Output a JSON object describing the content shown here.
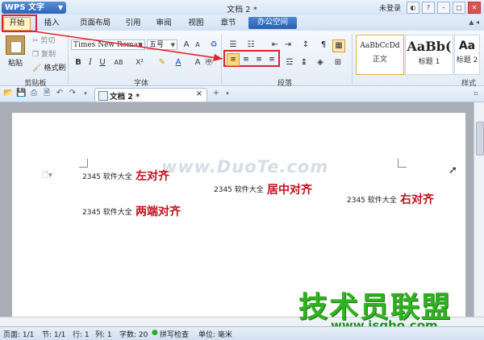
{
  "title_bar": {
    "app_name": "WPS 文字",
    "doc_title": "文档 2 *",
    "login": "未登录"
  },
  "tabs": [
    "开始",
    "插入",
    "页面布局",
    "引用",
    "审阅",
    "视图",
    "章节",
    "办公空间"
  ],
  "ribbon": {
    "clipboard": {
      "paste": "粘贴",
      "cut": "剪切",
      "copy": "复制",
      "format_painter": "格式刷",
      "group_label": "剪贴板"
    },
    "font": {
      "font_name": "Times New Roman",
      "font_size": "五号",
      "group_label": "字体"
    },
    "paragraph": {
      "group_label": "段落"
    },
    "styles": {
      "group_label": "样式",
      "cards": [
        {
          "preview": "AaBbCcDd",
          "label": "正文"
        },
        {
          "preview": "AaBb(",
          "label": "标题 1"
        },
        {
          "preview": "Aa",
          "label": "标题 2"
        }
      ]
    }
  },
  "doc_tab": {
    "label": "文档 2 *"
  },
  "document": {
    "left_small": "2345 软件大全",
    "left_big": "左对齐",
    "center_small": "2345 软件大全",
    "center_big": "居中对齐",
    "right_small": "2345 软件大全",
    "right_big": "右对齐",
    "justify_small": "2345 软件大全",
    "justify_big": "两端对齐",
    "watermark": "www.DuoTe.com"
  },
  "brand": {
    "name": "技术员联盟",
    "url": "www.jsgho.com"
  },
  "status_bar": {
    "page": "页面: 1/1",
    "section": "节: 1/1",
    "row": "行: 1",
    "col": "列: 1",
    "words": "字数: 20",
    "spell": "拼写检查",
    "unit": "单位: 毫米"
  },
  "colors": {
    "highlight": "#e0232e",
    "sample_text": "#c0101a",
    "brand_green": "#2fb41f"
  }
}
